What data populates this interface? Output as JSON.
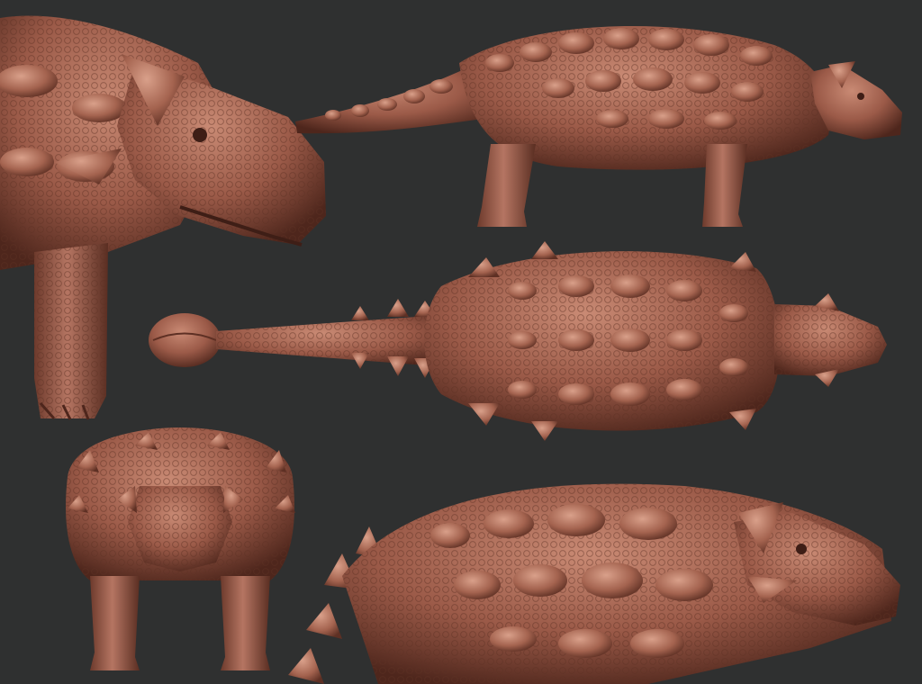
{
  "scene": {
    "subject": "ankylosaur-sculpt-turnaround",
    "background_color": "#2f3030",
    "sculpt_colors": {
      "base": "#9b5a48",
      "light": "#c98a74",
      "shadow": "#5e3024",
      "deep": "#3e1e16"
    },
    "views": [
      {
        "id": "head-closeup",
        "label": ""
      },
      {
        "id": "side-profile",
        "label": ""
      },
      {
        "id": "top-down",
        "label": ""
      },
      {
        "id": "front",
        "label": ""
      },
      {
        "id": "three-quarter",
        "label": ""
      }
    ]
  }
}
